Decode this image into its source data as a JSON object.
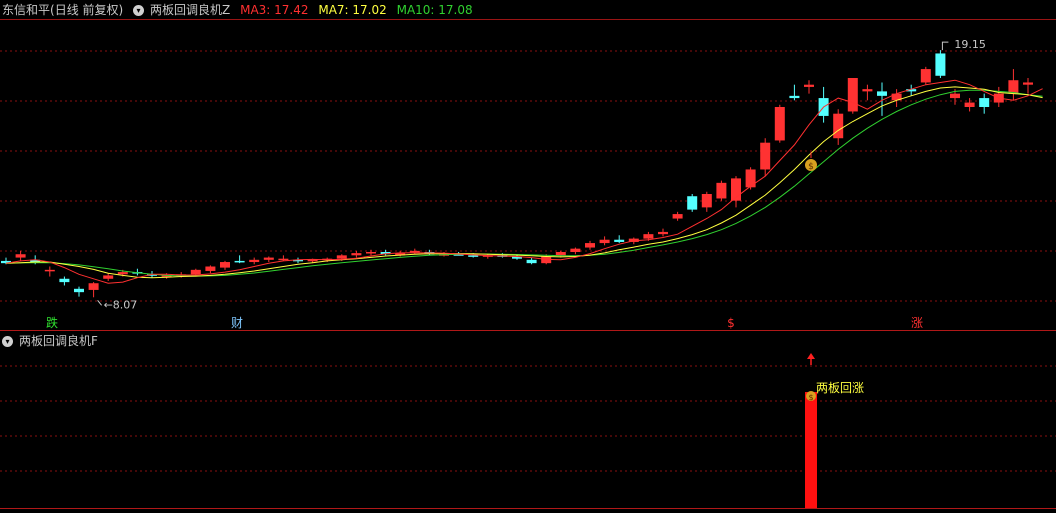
{
  "header": {
    "stock": "东信和平",
    "mode": "(日线 前复权)",
    "indicator": "两板回调良机Z",
    "ma": [
      {
        "label": "MA3: 17.42",
        "color": "#ff3030"
      },
      {
        "label": "MA7: 17.02",
        "color": "#ffff40"
      },
      {
        "label": "MA10: 17.08",
        "color": "#30d030"
      }
    ]
  },
  "sub_header": {
    "indicator": "两板回调良机F"
  },
  "markers": {
    "low": "8.07",
    "high": "19.15",
    "fall": "跌",
    "wealth": "财",
    "dollar": "$",
    "rise": "涨",
    "signal": "两板回涨",
    "bag": "$"
  },
  "colors": {
    "up": "#ff3232",
    "down": "#54ffff",
    "ma3": "#ff3030",
    "ma7": "#ffff40",
    "ma10": "#30d030",
    "grid": "#8a1010",
    "bar": "#ff1010"
  },
  "chart_data": {
    "type": "candlestick",
    "price_range": [
      7.5,
      20.5
    ],
    "ohlc": [
      [
        9.7,
        9.85,
        9.55,
        9.6
      ],
      [
        9.85,
        10.15,
        9.7,
        10.0
      ],
      [
        9.75,
        9.95,
        9.55,
        9.65
      ],
      [
        9.25,
        9.45,
        9.0,
        9.3
      ],
      [
        8.9,
        9.0,
        8.6,
        8.75
      ],
      [
        8.45,
        8.55,
        8.1,
        8.3
      ],
      [
        8.4,
        8.75,
        8.07,
        8.7
      ],
      [
        8.9,
        9.15,
        8.8,
        9.05
      ],
      [
        9.1,
        9.3,
        9.0,
        9.2
      ],
      [
        9.2,
        9.35,
        9.05,
        9.15
      ],
      [
        9.1,
        9.25,
        8.95,
        9.05
      ],
      [
        9.0,
        9.15,
        8.9,
        9.05
      ],
      [
        9.05,
        9.2,
        8.95,
        9.1
      ],
      [
        9.1,
        9.35,
        9.05,
        9.3
      ],
      [
        9.25,
        9.5,
        9.15,
        9.45
      ],
      [
        9.4,
        9.7,
        9.3,
        9.65
      ],
      [
        9.7,
        9.95,
        9.6,
        9.65
      ],
      [
        9.65,
        9.85,
        9.55,
        9.75
      ],
      [
        9.75,
        9.9,
        9.65,
        9.85
      ],
      [
        9.8,
        9.95,
        9.7,
        9.8
      ],
      [
        9.75,
        9.85,
        9.6,
        9.7
      ],
      [
        9.7,
        9.8,
        9.6,
        9.75
      ],
      [
        9.75,
        9.85,
        9.65,
        9.8
      ],
      [
        9.8,
        10.0,
        9.7,
        9.95
      ],
      [
        9.95,
        10.15,
        9.85,
        10.05
      ],
      [
        10.05,
        10.2,
        9.95,
        10.1
      ],
      [
        10.1,
        10.2,
        9.95,
        10.0
      ],
      [
        9.95,
        10.15,
        9.9,
        10.05
      ],
      [
        10.1,
        10.25,
        10.0,
        10.15
      ],
      [
        10.1,
        10.2,
        9.95,
        10.0
      ],
      [
        10.0,
        10.1,
        9.9,
        10.0
      ],
      [
        10.0,
        10.1,
        9.95,
        9.95
      ],
      [
        9.95,
        10.05,
        9.85,
        9.9
      ],
      [
        9.9,
        10.0,
        9.8,
        9.95
      ],
      [
        9.95,
        10.05,
        9.85,
        9.9
      ],
      [
        9.9,
        10.0,
        9.75,
        9.8
      ],
      [
        9.75,
        9.85,
        9.55,
        9.6
      ],
      [
        9.6,
        10.0,
        9.55,
        9.9
      ],
      [
        9.95,
        10.15,
        9.85,
        10.1
      ],
      [
        10.1,
        10.3,
        10.0,
        10.25
      ],
      [
        10.3,
        10.6,
        10.2,
        10.5
      ],
      [
        10.5,
        10.8,
        10.4,
        10.65
      ],
      [
        10.65,
        10.85,
        10.5,
        10.55
      ],
      [
        10.55,
        10.75,
        10.45,
        10.7
      ],
      [
        10.7,
        11.0,
        10.6,
        10.9
      ],
      [
        10.9,
        11.15,
        10.8,
        11.0
      ],
      [
        11.6,
        11.9,
        11.5,
        11.8
      ],
      [
        12.6,
        12.7,
        11.9,
        12.0
      ],
      [
        12.1,
        12.8,
        11.9,
        12.7
      ],
      [
        12.5,
        13.3,
        12.4,
        13.2
      ],
      [
        12.4,
        13.5,
        12.1,
        13.4
      ],
      [
        13.0,
        13.9,
        12.9,
        13.8
      ],
      [
        13.8,
        15.2,
        13.5,
        15.0
      ],
      [
        15.1,
        16.7,
        15.0,
        16.6
      ],
      [
        17.1,
        17.6,
        16.9,
        17.0
      ],
      [
        17.5,
        17.8,
        17.2,
        17.6
      ],
      [
        17.0,
        17.5,
        15.9,
        16.2
      ],
      [
        15.2,
        16.5,
        14.9,
        16.3
      ],
      [
        16.4,
        17.9,
        16.3,
        17.9
      ],
      [
        17.3,
        17.6,
        16.9,
        17.4
      ],
      [
        17.3,
        17.7,
        16.2,
        17.1
      ],
      [
        16.9,
        17.4,
        16.6,
        17.2
      ],
      [
        17.4,
        17.6,
        17.1,
        17.3
      ],
      [
        17.7,
        18.4,
        17.6,
        18.3
      ],
      [
        19.0,
        19.15,
        17.9,
        18.0
      ],
      [
        17.0,
        17.4,
        16.7,
        17.2
      ],
      [
        16.6,
        17.0,
        16.4,
        16.8
      ],
      [
        17.0,
        17.2,
        16.3,
        16.6
      ],
      [
        16.8,
        17.5,
        16.6,
        17.2
      ],
      [
        17.2,
        18.3,
        16.9,
        17.8
      ],
      [
        17.6,
        17.9,
        17.2,
        17.7
      ]
    ],
    "ma3": [
      9.6,
      9.7,
      9.75,
      9.65,
      9.4,
      9.1,
      8.9,
      8.7,
      8.75,
      8.95,
      9.1,
      9.1,
      9.07,
      9.07,
      9.12,
      9.2,
      9.3,
      9.45,
      9.6,
      9.7,
      9.75,
      9.77,
      9.75,
      9.77,
      9.82,
      9.92,
      10.02,
      10.06,
      10.07,
      10.06,
      10.05,
      10.01,
      9.97,
      9.94,
      9.92,
      9.9,
      9.85,
      9.77,
      9.75,
      9.86,
      10.03,
      10.25,
      10.45,
      10.6,
      10.65,
      10.75,
      10.9,
      11.25,
      11.6,
      12.0,
      12.55,
      13.05,
      13.5,
      14.2,
      14.9,
      15.8,
      16.6,
      17.0,
      16.8,
      16.5,
      16.9,
      17.2,
      17.4,
      17.6,
      17.7,
      17.8,
      17.6,
      17.3,
      17.0,
      16.9,
      17.1,
      17.42
    ],
    "ma7": [
      9.6,
      9.62,
      9.65,
      9.65,
      9.55,
      9.45,
      9.32,
      9.15,
      9.05,
      8.97,
      8.95,
      8.97,
      9.0,
      9.02,
      9.05,
      9.1,
      9.17,
      9.25,
      9.35,
      9.45,
      9.55,
      9.62,
      9.7,
      9.75,
      9.8,
      9.86,
      9.92,
      9.96,
      10.0,
      10.02,
      10.03,
      10.03,
      10.02,
      10.0,
      9.98,
      9.96,
      9.93,
      9.9,
      9.88,
      9.9,
      9.96,
      10.06,
      10.2,
      10.32,
      10.45,
      10.55,
      10.7,
      10.88,
      11.1,
      11.4,
      11.75,
      12.2,
      12.65,
      13.2,
      13.8,
      14.45,
      15.05,
      15.55,
      15.95,
      16.3,
      16.65,
      16.9,
      17.1,
      17.3,
      17.45,
      17.5,
      17.45,
      17.4,
      17.25,
      17.2,
      17.15,
      17.02
    ],
    "ma10": [
      9.6,
      9.61,
      9.62,
      9.62,
      9.58,
      9.52,
      9.44,
      9.35,
      9.25,
      9.17,
      9.1,
      9.05,
      9.03,
      9.02,
      9.03,
      9.05,
      9.1,
      9.16,
      9.24,
      9.32,
      9.4,
      9.48,
      9.55,
      9.62,
      9.68,
      9.74,
      9.8,
      9.86,
      9.91,
      9.95,
      9.98,
      10.0,
      10.01,
      10.01,
      10.0,
      9.99,
      9.97,
      9.95,
      9.93,
      9.93,
      9.95,
      10.0,
      10.08,
      10.18,
      10.3,
      10.42,
      10.55,
      10.7,
      10.88,
      11.1,
      11.38,
      11.72,
      12.1,
      12.55,
      13.05,
      13.6,
      14.15,
      14.7,
      15.2,
      15.65,
      16.05,
      16.4,
      16.7,
      16.95,
      17.15,
      17.3,
      17.35,
      17.35,
      17.3,
      17.25,
      17.15,
      17.08
    ],
    "signal_bar_index": 55
  }
}
